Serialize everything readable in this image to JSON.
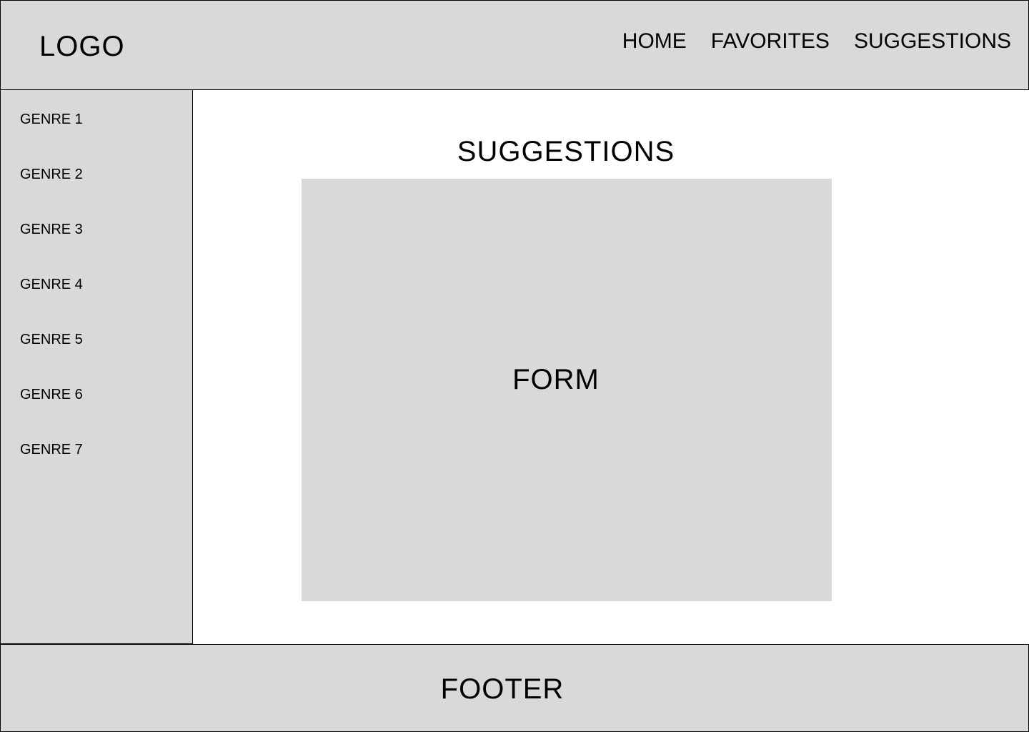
{
  "header": {
    "logo": "LOGO",
    "nav": [
      {
        "label": "HOME"
      },
      {
        "label": "FAVORITES"
      },
      {
        "label": "SUGGESTIONS"
      }
    ]
  },
  "sidebar": {
    "items": [
      {
        "label": "GENRE 1"
      },
      {
        "label": "GENRE 2"
      },
      {
        "label": "GENRE 3"
      },
      {
        "label": "GENRE 4"
      },
      {
        "label": "GENRE 5"
      },
      {
        "label": "GENRE 6"
      },
      {
        "label": "GENRE 7"
      }
    ]
  },
  "main": {
    "title": "SUGGESTIONS",
    "form_label": "FORM"
  },
  "footer": {
    "label": "FOOTER"
  },
  "colors": {
    "panel": "#d9d9d9",
    "border": "#000000",
    "background": "#ffffff"
  }
}
